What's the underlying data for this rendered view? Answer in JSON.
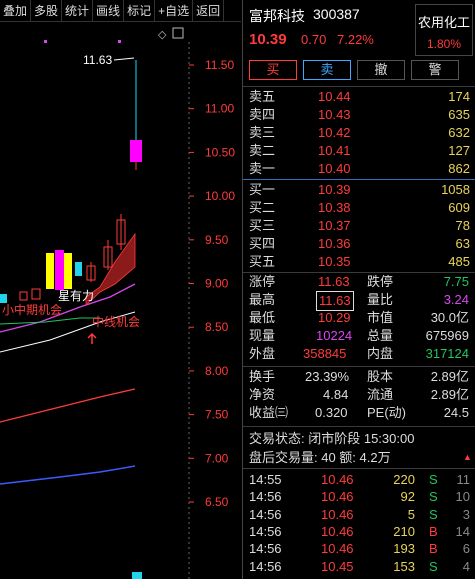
{
  "toolbar": {
    "items": [
      "叠加",
      "多股",
      "统计",
      "画线",
      "标记",
      "+自选",
      "返回"
    ]
  },
  "chart": {
    "price_labels": [
      "11.50",
      "11.00",
      "10.50",
      "10.00",
      "9.50",
      "9.00",
      "8.50",
      "8.00",
      "7.50",
      "7.00",
      "6.50"
    ],
    "high_annotation": "11.63",
    "annotations": [
      "星有力",
      "小中期机会",
      "中线机会"
    ],
    "colors": {
      "up": "#ff3b3b",
      "down": "#22d3ee",
      "ma_white": "#ffffff",
      "ma_magenta": "#d946ef",
      "ma_red": "#ff3b3b",
      "ma_blue": "#3b5bff"
    }
  },
  "header": {
    "name": "富邦科技",
    "code": "300387",
    "price": "10.39",
    "change": "0.70",
    "change_pct": "7.22%",
    "sector_name": "农用化工",
    "sector_pct": "1.80%"
  },
  "trade_buttons": {
    "buy": "买",
    "sell": "卖",
    "cancel": "撤",
    "alert": "警"
  },
  "asks": [
    {
      "label": "卖五",
      "price": "10.44",
      "vol": "174"
    },
    {
      "label": "卖四",
      "price": "10.43",
      "vol": "635"
    },
    {
      "label": "卖三",
      "price": "10.42",
      "vol": "632"
    },
    {
      "label": "卖二",
      "price": "10.41",
      "vol": "127"
    },
    {
      "label": "卖一",
      "price": "10.40",
      "vol": "862"
    }
  ],
  "bids": [
    {
      "label": "买一",
      "price": "10.39",
      "vol": "1058"
    },
    {
      "label": "买二",
      "price": "10.38",
      "vol": "609"
    },
    {
      "label": "买三",
      "price": "10.37",
      "vol": "78"
    },
    {
      "label": "买四",
      "price": "10.36",
      "vol": "63"
    },
    {
      "label": "买五",
      "price": "10.35",
      "vol": "485"
    }
  ],
  "stats": {
    "limit_up_k": "涨停",
    "limit_up": "11.63",
    "limit_down_k": "跌停",
    "limit_down": "7.75",
    "high_k": "最高",
    "high": "11.63",
    "vol_ratio_k": "量比",
    "vol_ratio": "3.24",
    "low_k": "最低",
    "low": "10.29",
    "mkt_val_k": "市值",
    "mkt_val": "30.0亿",
    "cur_vol_k": "现量",
    "cur_vol": "10224",
    "total_vol_k": "总量",
    "total_vol": "675969",
    "outer_k": "外盘",
    "outer": "358845",
    "inner_k": "内盘",
    "inner": "317124",
    "turnover_k": "换手",
    "turnover": "23.39%",
    "equity_k": "股本",
    "equity": "2.89亿",
    "nav_k": "净资",
    "nav": "4.84",
    "float_k": "流通",
    "float": "2.89亿",
    "eps_k": "收益㈢",
    "eps": "0.320",
    "pe_k": "PE(动)",
    "pe": "24.5"
  },
  "status": {
    "trade_status": "交易状态: 闭市阶段 15:30:00",
    "after_hours": "盘后交易量: 40  额: 4.2万"
  },
  "ticks": [
    {
      "time": "14:55",
      "price": "10.46",
      "vol": "220",
      "dir": "S",
      "n": "11"
    },
    {
      "time": "14:56",
      "price": "10.46",
      "vol": "92",
      "dir": "S",
      "n": "10"
    },
    {
      "time": "14:56",
      "price": "10.46",
      "vol": "5",
      "dir": "S",
      "n": "3"
    },
    {
      "time": "14:56",
      "price": "10.46",
      "vol": "210",
      "dir": "B",
      "n": "14"
    },
    {
      "time": "14:56",
      "price": "10.46",
      "vol": "193",
      "dir": "B",
      "n": "6"
    },
    {
      "time": "14:56",
      "price": "10.45",
      "vol": "153",
      "dir": "S",
      "n": "4"
    }
  ]
}
